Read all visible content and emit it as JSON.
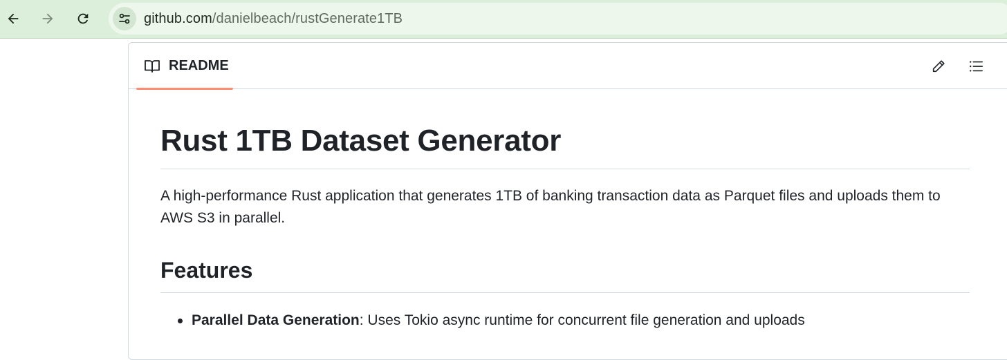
{
  "browser": {
    "back_icon": "arrow-left-icon",
    "forward_icon": "arrow-right-icon",
    "reload_icon": "reload-icon",
    "site_info_icon": "tune-icon",
    "url_host": "github.com",
    "url_path": "/danielbeach/rustGenerate1TB"
  },
  "readme": {
    "tab_label": "README",
    "tab_icon": "book-icon",
    "edit_icon": "pencil-icon",
    "outline_icon": "list-icon",
    "accent": "#fd8c73"
  },
  "content": {
    "title": "Rust 1TB Dataset Generator",
    "intro": "A high-performance Rust application that generates 1TB of banking transaction data as Parquet files and uploads them to AWS S3 in parallel.",
    "features_heading": "Features",
    "features": [
      {
        "term": "Parallel Data Generation",
        "description": ": Uses Tokio async runtime for concurrent file generation and uploads"
      }
    ]
  }
}
